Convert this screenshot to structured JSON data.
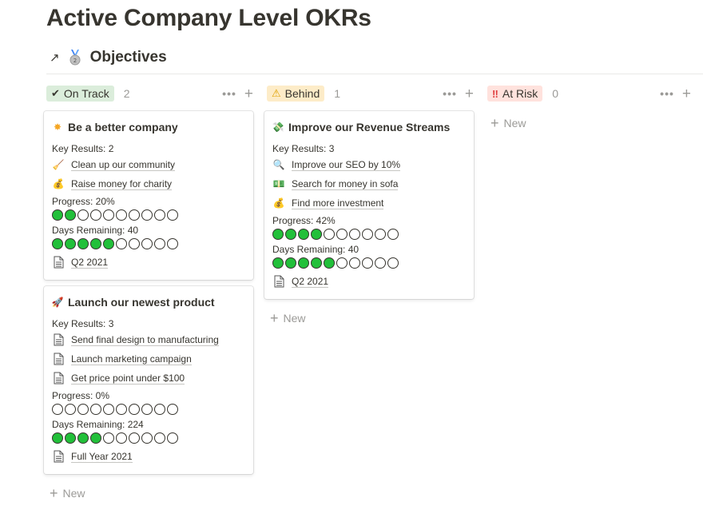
{
  "page": {
    "title": "Active Company Level OKRs"
  },
  "database": {
    "title": "Objectives",
    "icon": "medal-icon"
  },
  "colors": {
    "on_track_bg": "#dbeddb",
    "behind_bg": "#fdecc8",
    "at_risk_bg": "#ffe2dd",
    "filled_dot": "#22c03a"
  },
  "columns": [
    {
      "name": "On Track",
      "emoji": "✔",
      "count": "2",
      "cards": [
        {
          "title": "Be a better company",
          "icon": "✸",
          "key_results_label": "Key Results: 2",
          "key_results": [
            {
              "icon": "🧹",
              "text": "Clean up our community"
            },
            {
              "icon": "💰",
              "text": "Raise money for charity"
            }
          ],
          "progress_label": "Progress: 20%",
          "progress": 0.2,
          "days_label": "Days Remaining: 40",
          "days_filled": 5,
          "period": "Q2 2021"
        },
        {
          "title": "Launch our newest product",
          "icon": "🚀",
          "key_results_label": "Key Results: 3",
          "key_results": [
            {
              "icon": "doc",
              "text": "Send final design to manufacturing"
            },
            {
              "icon": "doc",
              "text": "Launch marketing campaign"
            },
            {
              "icon": "doc",
              "text": "Get price point under $100"
            }
          ],
          "progress_label": "Progress: 0%",
          "progress": 0,
          "days_label": "Days Remaining: 224",
          "days_filled": 4,
          "period": "Full Year 2021"
        }
      ],
      "new_label": "New"
    },
    {
      "name": "Behind",
      "emoji": "⚠",
      "count": "1",
      "cards": [
        {
          "title": "Improve our Revenue Streams",
          "icon": "💸",
          "key_results_label": "Key Results: 3",
          "key_results": [
            {
              "icon": "🔍",
              "text": "Improve our SEO by 10%"
            },
            {
              "icon": "💵",
              "text": "Search for money in sofa"
            },
            {
              "icon": "💰",
              "text": "Find more investment"
            }
          ],
          "progress_label": "Progress: 42%",
          "progress": 0.42,
          "days_label": "Days Remaining: 40",
          "days_filled": 5,
          "period": "Q2 2021"
        }
      ],
      "new_label": "New"
    },
    {
      "name": "At Risk",
      "emoji": "‼",
      "count": "0",
      "cards": [],
      "new_label": "New"
    }
  ]
}
